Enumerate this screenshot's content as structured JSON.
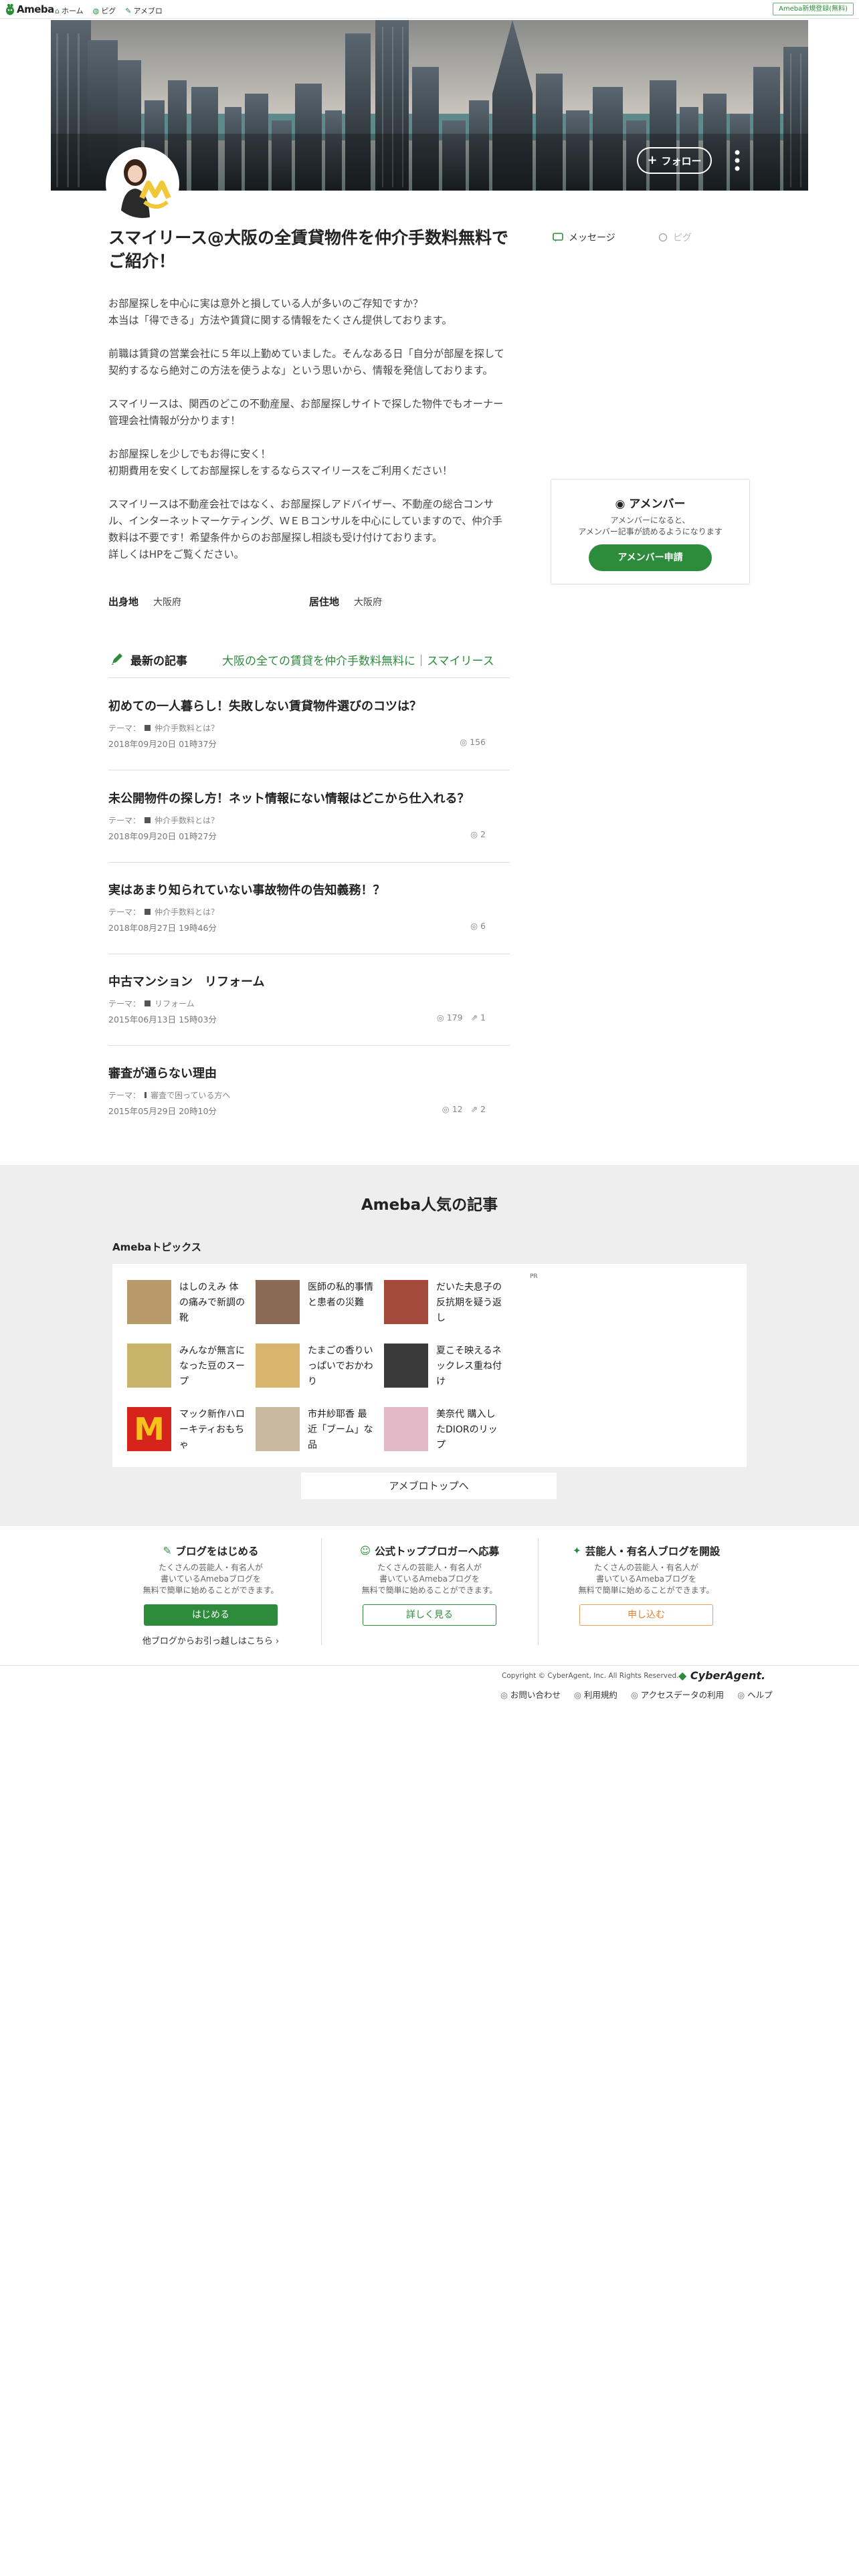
{
  "global_nav": {
    "logo": "Ameba",
    "items": [
      {
        "icon": "home-icon",
        "label": "ホーム"
      },
      {
        "icon": "pig-icon",
        "label": "ピグ"
      },
      {
        "icon": "ameblo-icon",
        "label": "アメブロ"
      }
    ],
    "register": "Ameba新規登録(無料)"
  },
  "header": {
    "follow": "フォロー"
  },
  "blog": {
    "title": "スマイリース@大阪の全賃貸物件を仲介手数料無料でご紹介！",
    "description": "お部屋探しを中心に実は意外と損している人が多いのご存知ですか？\n本当は「得できる」方法や賃貸に関する情報をたくさん提供しております。\n\n前職は賃貸の営業会社に５年以上勤めていました。そんなある日「自分が部屋を探して契約するなら絶対この方法を使うよな」という思いから、情報を発信しております。\n\nスマイリースは、関西のどこの不動産屋、お部屋探しサイトで探した物件でもオーナー管理会社情報が分かります！\n\nお部屋探しを少しでもお得に安く！\n初期費用を安くしてお部屋探しをするならスマイリースをご利用ください！\n\nスマイリースは不動産会社ではなく、お部屋探しアドバイザー、不動産の総合コンサル、インターネットマーケティング、ＷＥＢコンサルを中心にしていますので、仲介手数料は不要です！希望条件からのお部屋探し相談も受け付けております。\n詳しくはHPをご覧ください。",
    "birthplace_label": "出身地",
    "birthplace": "大阪府",
    "residence_label": "居住地",
    "residence": "大阪府"
  },
  "latest": {
    "heading": "最新の記事",
    "link": "大阪の全ての賃貸を仲介手数料無料に｜スマイリース",
    "articles": [
      {
        "title": "初めての一人暮らし！失敗しない賃貸物件選びのコツは？",
        "theme_label": "テーマ：",
        "theme": "仲介手数料とは？",
        "date": "2018年09月20日 01時37分",
        "likes": "156",
        "reblogs": ""
      },
      {
        "title": "未公開物件の探し方！ネット情報にない情報はどこから仕入れる？",
        "theme_label": "テーマ：",
        "theme": "仲介手数料とは？",
        "date": "2018年09月20日 01時27分",
        "likes": "2",
        "reblogs": ""
      },
      {
        "title": "実はあまり知られていない事故物件の告知義務！？",
        "theme_label": "テーマ：",
        "theme": "仲介手数料とは？",
        "date": "2018年08月27日 19時46分",
        "likes": "6",
        "reblogs": ""
      },
      {
        "title": "中古マンション　リフォーム",
        "theme_label": "テーマ：",
        "theme": "リフォーム",
        "date": "2015年06月13日 15時03分",
        "likes": "179",
        "reblogs": "1"
      },
      {
        "title": "審査が通らない理由",
        "theme_label": "テーマ：",
        "theme": "審査で困っている方へ",
        "date": "2015年05月29日 20時10分",
        "likes": "12",
        "reblogs": "2"
      }
    ]
  },
  "sidebar": {
    "message": "メッセージ",
    "pig": "ピグ",
    "amember": {
      "title": "アメンバー",
      "desc": "アメンバーになると、\nアメンバー記事が読めるようになります",
      "button": "アメンバー申請"
    }
  },
  "popular": {
    "title": "Ameba人気の記事",
    "subtitle": "Amebaトピックス",
    "pr": "PR",
    "items": [
      {
        "text": "はしのえみ 体の痛みで新調の靴",
        "thumb": "#b89a6a"
      },
      {
        "text": "医師の私的事情と患者の災難",
        "thumb": "#8a6a55"
      },
      {
        "text": "だいた夫息子の反抗期を疑う返し",
        "thumb": "#a34a3a"
      },
      {
        "text": "みんなが無言になった豆のスープ",
        "thumb": "#c9b26a"
      },
      {
        "text": "たまごの香りいっぱいでおかわり",
        "thumb": "#d8b46c"
      },
      {
        "text": "夏こそ映えるネックレス重ね付け",
        "thumb": "#3a3a3a"
      },
      {
        "text": "マック新作ハローキティおもちゃ",
        "thumb": "#d6241c"
      },
      {
        "text": "市井紗耶香 最近「ブーム」な品",
        "thumb": "#c9b8a0"
      },
      {
        "text": "美奈代 購入したDIORのリップ",
        "thumb": "#e3b9c7"
      }
    ],
    "top_button": "アメブロトップへ"
  },
  "cta": [
    {
      "title": "ブログをはじめる",
      "desc": "たくさんの芸能人・有名人が\n書いているAmebaブログを\n無料で簡単に始めることができます。",
      "button": "はじめる",
      "link": "他ブログからお引っ越しはこちら"
    },
    {
      "title": "公式トップブロガーへ応募",
      "desc": "たくさんの芸能人・有名人が\n書いているAmebaブログを\n無料で簡単に始めることができます。",
      "button": "詳しく見る",
      "link": ""
    },
    {
      "title": "芸能人・有名人ブログを開設",
      "desc": "たくさんの芸能人・有名人が\n書いているAmebaブログを\n無料で簡単に始めることができます。",
      "button": "申し込む",
      "link": ""
    }
  ],
  "footer": {
    "copyright": "Copyright © CyberAgent, Inc. All Rights Reserved.",
    "brand": "CyberAgent.",
    "links": [
      "お問い合わせ",
      "利用規約",
      "アクセスデータの利用",
      "ヘルプ"
    ]
  },
  "colors": {
    "accent": "#2d8c3c",
    "orange": "#e08030"
  }
}
